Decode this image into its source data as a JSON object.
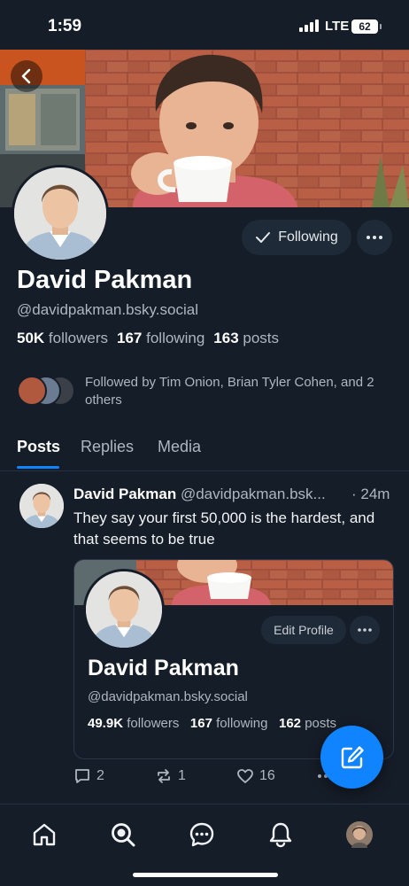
{
  "status_bar": {
    "time": "1:59",
    "network": "LTE",
    "battery": "62"
  },
  "profile": {
    "display_name": "David Pakman",
    "handle": "@davidpakman.bsky.social",
    "following_button_label": "Following",
    "stats": {
      "followers_count": "50K",
      "followers_label": "followers",
      "following_count": "167",
      "following_label": "following",
      "posts_count": "163",
      "posts_label": "posts"
    },
    "followed_by_text": "Followed by Tim Onion, Brian Tyler Cohen, and 2 others"
  },
  "tabs": [
    {
      "label": "Posts",
      "active": true
    },
    {
      "label": "Replies",
      "active": false
    },
    {
      "label": "Media",
      "active": false
    }
  ],
  "post": {
    "author": "David Pakman",
    "handle": "@davidpakman.bsk...",
    "time": "· 24m",
    "text": "They say your first 50,000 is the hardest, and that seems to be true",
    "embed": {
      "edit_profile_label": "Edit Profile",
      "display_name": "David Pakman",
      "handle": "@davidpakman.bsky.social",
      "followers_count": "49.9K",
      "followers_label": "followers",
      "following_count": "167",
      "following_label": "following",
      "posts_count": "162",
      "posts_label": "posts"
    },
    "actions": {
      "replies": "2",
      "reposts": "1",
      "likes": "16"
    }
  },
  "nav": {
    "items": [
      "home-icon",
      "search-icon",
      "chat-icon",
      "bell-icon",
      "profile-avatar"
    ]
  },
  "colors": {
    "background": "#151d28",
    "accent": "#1083fe",
    "muted_text": "#aeb6c0"
  }
}
